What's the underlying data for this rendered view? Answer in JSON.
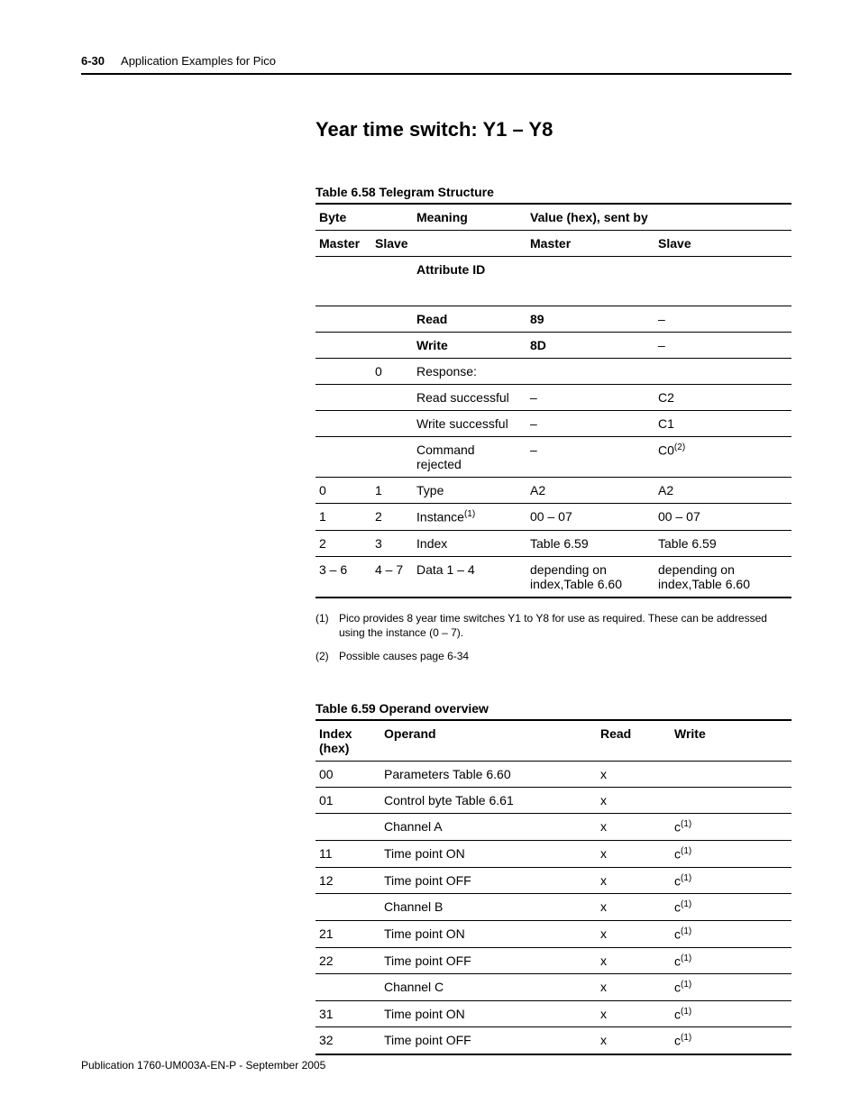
{
  "header": {
    "page_num": "6-30",
    "title": "Application Examples for Pico"
  },
  "section": {
    "title": "Year time switch: Y1 – Y8"
  },
  "table1": {
    "caption": "Table 6.58 Telegram Structure",
    "top": {
      "byte": "Byte",
      "meaning": "Meaning",
      "value": "Value (hex), sent by"
    },
    "sub": {
      "master": "Master",
      "slave": "Slave",
      "master_v": "Master",
      "slave_v": "Slave"
    },
    "rows": [
      {
        "m": "",
        "s": "",
        "mean": "Attribute ID",
        "mv": "",
        "sv": "",
        "bold": true,
        "tall": true
      },
      {
        "m": "",
        "s": "",
        "mean": "Read",
        "mv": "89",
        "sv": "–",
        "bold": true
      },
      {
        "m": "",
        "s": "",
        "mean": "Write",
        "mv": "8D",
        "sv": "–",
        "bold": true
      },
      {
        "m": "",
        "s": "0",
        "mean": "Response:",
        "mv": "",
        "sv": ""
      },
      {
        "m": "",
        "s": "",
        "mean": "Read successful",
        "mv": "–",
        "sv": "C2"
      },
      {
        "m": "",
        "s": "",
        "mean": "Write successful",
        "mv": "–",
        "sv": "C1"
      },
      {
        "m": "",
        "s": "",
        "mean": "Command rejected",
        "mv": "–",
        "sv": "C0",
        "sv_sup": "(2)"
      },
      {
        "m": "0",
        "s": "1",
        "mean": "Type",
        "mv": "A2",
        "sv": "A2"
      },
      {
        "m": "1",
        "s": "2",
        "mean": "Instance",
        "mean_sup": "(1)",
        "mv": "00 – 07",
        "sv": "00 – 07"
      },
      {
        "m": "2",
        "s": "3",
        "mean": "Index",
        "mv": "Table 6.59",
        "sv": "Table 6.59"
      },
      {
        "m": "3 – 6",
        "s": "4 – 7",
        "mean": "Data 1 – 4",
        "mv": "depending on index,Table 6.60",
        "sv": "depending on index,Table 6.60",
        "last": true
      }
    ],
    "footnotes": [
      {
        "num": "(1)",
        "text": "Pico provides 8 year time switches Y1 to Y8 for use as required. These can be addressed using the instance (0 – 7)."
      },
      {
        "num": "(2)",
        "text": "Possible causes page 6-34"
      }
    ]
  },
  "table2": {
    "caption": "Table 6.59 Operand overview",
    "head": {
      "index": "Index (hex)",
      "operand": "Operand",
      "read": "Read",
      "write": "Write"
    },
    "c_sup": "(1)",
    "rows": [
      {
        "i": "00",
        "o": "Parameters Table 6.60",
        "r": "x",
        "w": ""
      },
      {
        "i": "01",
        "o": "Control byte Table 6.61",
        "r": "x",
        "w": ""
      },
      {
        "i": "",
        "o": "Channel A",
        "r": "x",
        "w": "c",
        "w_sup": true
      },
      {
        "i": "11",
        "o": "Time point ON",
        "r": "x",
        "w": "c",
        "w_sup": true
      },
      {
        "i": "12",
        "o": "Time point OFF",
        "r": "x",
        "w": "c",
        "w_sup": true
      },
      {
        "i": "",
        "o": "Channel B",
        "r": "x",
        "w": "c",
        "w_sup": true
      },
      {
        "i": "21",
        "o": "Time point ON",
        "r": "x",
        "w": "c",
        "w_sup": true
      },
      {
        "i": "22",
        "o": "Time point OFF",
        "r": "x",
        "w": "c",
        "w_sup": true
      },
      {
        "i": "",
        "o": "Channel C",
        "r": "x",
        "w": "c",
        "w_sup": true
      },
      {
        "i": "31",
        "o": "Time point ON",
        "r": "x",
        "w": "c",
        "w_sup": true
      },
      {
        "i": "32",
        "o": "Time point OFF",
        "r": "x",
        "w": "c",
        "w_sup": true
      }
    ]
  },
  "pub_line": "Publication 1760-UM003A-EN-P - September 2005"
}
